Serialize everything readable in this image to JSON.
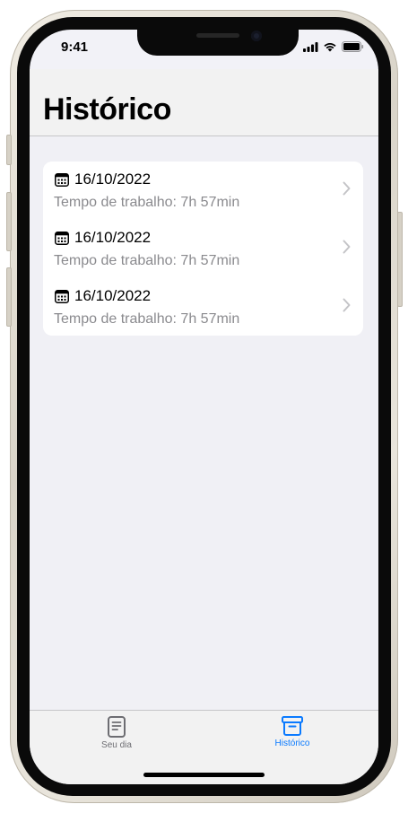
{
  "status_bar": {
    "time": "9:41"
  },
  "nav": {
    "title": "Histórico"
  },
  "history": [
    {
      "date": "16/10/2022",
      "work_time": "Tempo de trabalho: 7h 57min"
    },
    {
      "date": "16/10/2022",
      "work_time": "Tempo de trabalho: 7h 57min"
    },
    {
      "date": "16/10/2022",
      "work_time": "Tempo de trabalho: 7h 57min"
    }
  ],
  "tabs": [
    {
      "label": "Seu dia",
      "icon": "document-icon",
      "selected": false
    },
    {
      "label": "Histórico",
      "icon": "archive-box-icon",
      "selected": true
    }
  ],
  "colors": {
    "accent": "#0a7aff",
    "inactive_tab": "#6d6d72",
    "secondary_text": "#8a8a8e"
  }
}
